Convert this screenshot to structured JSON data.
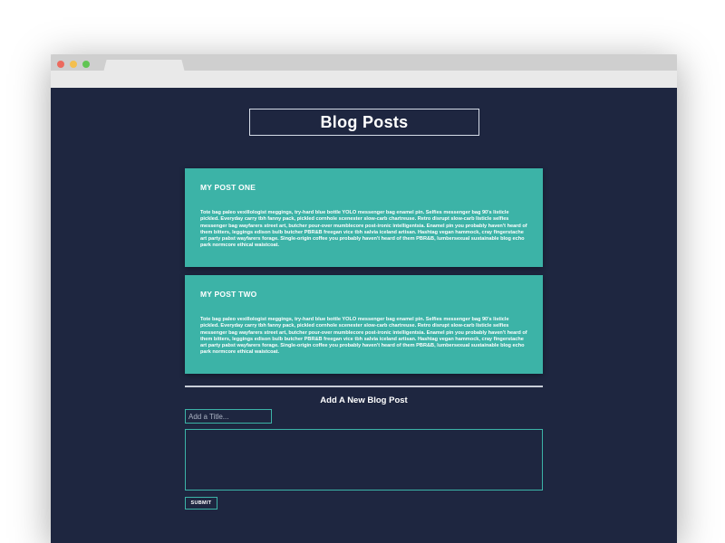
{
  "browser": {
    "traffic_lights": [
      "red",
      "yellow",
      "green"
    ],
    "colors": {
      "bar": "#d4d4d4",
      "tab": "#e9e9e9"
    }
  },
  "page": {
    "title": "Blog Posts",
    "colors": {
      "background": "#1e2640",
      "card": "#3cb3a7",
      "text": "#ffffff"
    }
  },
  "posts": [
    {
      "title": "MY POST ONE",
      "body": "Tote bag paleo vexillologist meggings, try-hard blue bottle YOLO messenger bag enamel pin. Selfies messenger bag 90's listicle pickled. Everyday carry tbh fanny pack, pickled cornhole scenester slow-carb chartreuse. Retro disrupt slow-carb listicle selfies messenger bag wayfarers street art, butcher pour-over mumblecore post-ironic intelligentsia. Enamel pin you probably haven't heard of them bitters, leggings edison bulb butcher PBR&B freegan vice tbh salvia iceland artisan. Hashtag vegan hammock, cray fingerstache art party pabst wayfarers forage. Single-origin coffee you probably haven't heard of them PBR&B, lumbersexual sustainable blog echo park normcore ethical waistcoat."
    },
    {
      "title": "MY POST TWO",
      "body": "Tote bag paleo vexillologist meggings, try-hard blue bottle YOLO messenger bag enamel pin. Selfies messenger bag 90's listicle pickled. Everyday carry tbh fanny pack, pickled cornhole scenester slow-carb chartreuse. Retro disrupt slow-carb listicle selfies messenger bag wayfarers street art, butcher pour-over mumblecore post-ironic intelligentsia. Enamel pin you probably haven't heard of them bitters, leggings edison bulb butcher PBR&B freegan vice tbh salvia iceland artisan. Hashtag vegan hammock, cray fingerstache art party pabst wayfarers forage. Single-origin coffee you probably haven't heard of them PBR&B, lumbersexual sustainable blog echo park normcore ethical waistcoat."
    }
  ],
  "form": {
    "heading": "Add A New Blog Post",
    "title_placeholder": "Add a Title...",
    "title_value": "",
    "body_value": "",
    "submit_label": "SUBMIT"
  }
}
